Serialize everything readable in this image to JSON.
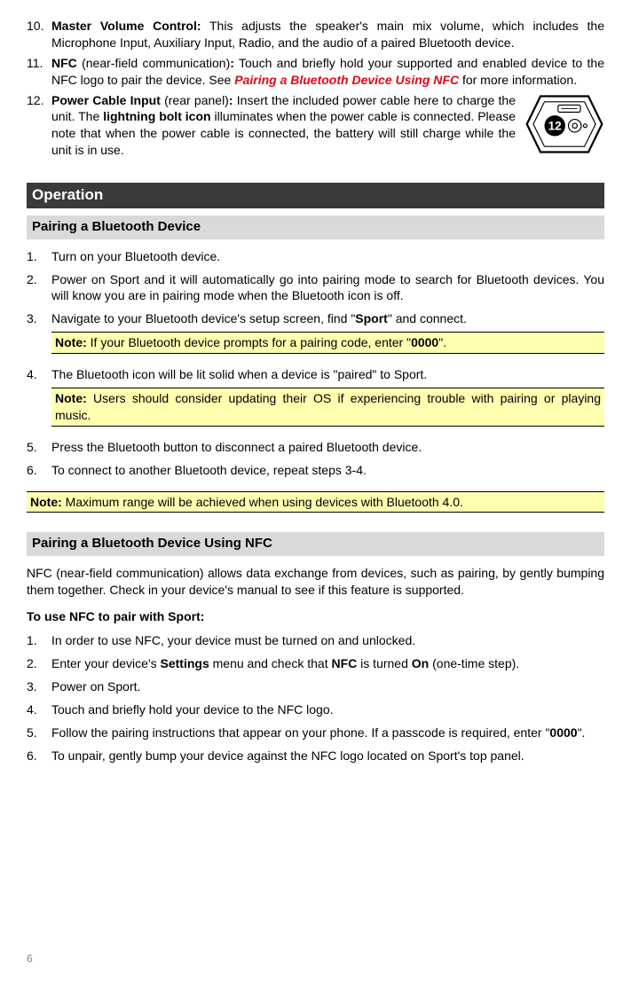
{
  "top": {
    "item10": {
      "num": "10.",
      "title": "Master Volume Control:",
      "text": " This adjusts the speaker's main mix volume, which includes the Microphone Input, Auxiliary Input, Radio, and the audio of a paired Bluetooth device."
    },
    "item11": {
      "num": "11.",
      "title": "NFC",
      "title2": " (near-field communication)",
      "colon": ":",
      "text1": " Touch and briefly hold your supported and enabled device to the NFC logo to pair the device. See ",
      "link": "Pairing a Bluetooth Device Using NFC",
      "text2": " for more information."
    },
    "item12": {
      "num": "12.",
      "title": "Power Cable Input",
      "paren": " (rear panel)",
      "colon": ":",
      "text1": " Insert the included power cable here to charge the unit. The ",
      "bold": "lightning bolt icon",
      "text2": " illuminates when the power cable is connected. Please note that when the power cable is connected, the battery will still charge while the unit is in use.",
      "badgeNum": "12"
    }
  },
  "operation": {
    "heading": "Operation",
    "sub1": "Pairing a Bluetooth Device",
    "steps1": {
      "s1": "Turn on your Bluetooth device.",
      "s2": "Power on Sport and it will automatically go into pairing mode to search for Bluetooth devices. You will know you are in pairing mode when the Bluetooth icon is off.",
      "s3a": "Navigate to your Bluetooth device's setup screen, find \"",
      "s3bold": "Sport",
      "s3b": "\" and connect.",
      "note1a": "Note:",
      "note1b": " If your Bluetooth device prompts for a pairing code, enter \"",
      "note1bold": "0000",
      "note1c": "\".",
      "s4": "The Bluetooth icon will be lit solid when a device is \"paired\" to Sport.",
      "note2a": "Note:",
      "note2b": " Users should consider updating their OS if experiencing trouble with pairing or playing music.",
      "s5": "Press the Bluetooth button to disconnect a paired Bluetooth device.",
      "s6": "To connect to another Bluetooth device, repeat steps 3-4."
    },
    "note3a": "Note:",
    "note3b": " Maximum range will be achieved when using devices with Bluetooth 4.0.",
    "sub2": "Pairing a Bluetooth Device Using NFC",
    "nfcIntro": "NFC (near-field communication) allows data exchange from devices, such as pairing, by gently bumping them together. Check in your device's manual to see if this feature is supported.",
    "nfcSubhead": "To use NFC to pair with Sport:",
    "steps2": {
      "s1": "In order to use NFC, your device must be turned on and unlocked.",
      "s2a": "Enter your device's ",
      "s2b1": "Settings",
      "s2c": " menu and check that ",
      "s2b2": "NFC",
      "s2d": " is turned ",
      "s2b3": "On",
      "s2e": " (one-time step).",
      "s3": "Power on Sport.",
      "s4": "Touch and briefly hold your device to the NFC logo.",
      "s5a": "Follow the pairing instructions that appear on your phone. If a passcode is required, enter \"",
      "s5bold": "0000",
      "s5b": "\".",
      "s6": "To unpair, gently bump your device against the NFC logo located on Sport's top panel."
    }
  },
  "pageNum": "6"
}
